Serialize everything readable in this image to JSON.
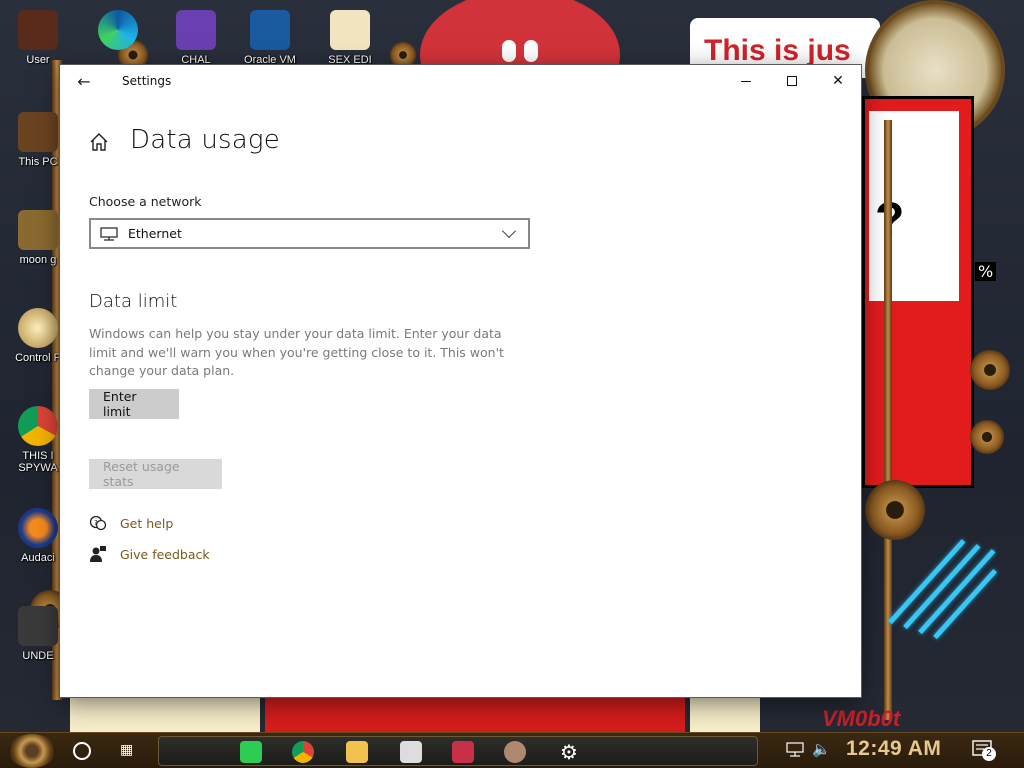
{
  "desktop": {
    "icons": [
      {
        "label": "User"
      },
      {
        "label": "This PC"
      },
      {
        "label": "moon g"
      },
      {
        "label": "Control P"
      },
      {
        "label": "THIS I"
      },
      {
        "label": "SPYWA"
      },
      {
        "label": "Audaci"
      },
      {
        "label": "UNDE"
      }
    ],
    "top_icons": [
      {
        "label": "CHAL"
      },
      {
        "label": "Oracle VM"
      },
      {
        "label": "SEX EDI"
      }
    ],
    "banner_text": "This is jus",
    "percent_text": "%",
    "vm_text": "VM0b0t"
  },
  "settings": {
    "window_title": "Settings",
    "page_title": "Data usage",
    "network_label": "Choose a network",
    "network_value": "Ethernet",
    "data_limit_title": "Data limit",
    "data_limit_description": "Windows can help you stay under your data limit. Enter your data limit and we'll warn you when you're getting close to it. This won't change your data plan.",
    "enter_limit_button": "Enter limit",
    "reset_stats_button": "Reset usage stats",
    "get_help_link": "Get help",
    "give_feedback_link": "Give feedback"
  },
  "taskbar": {
    "clock": "12:49 AM",
    "notification_count": "2",
    "apps": [
      "spotify",
      "chrome",
      "file-explorer",
      "skull-app",
      "media-app",
      "portrait-app",
      "settings"
    ]
  },
  "colors": {
    "link": "#7a5a1e",
    "button_bg": "#cccccc",
    "disabled_text": "#9a9a9a",
    "clock": "#e8c890"
  }
}
